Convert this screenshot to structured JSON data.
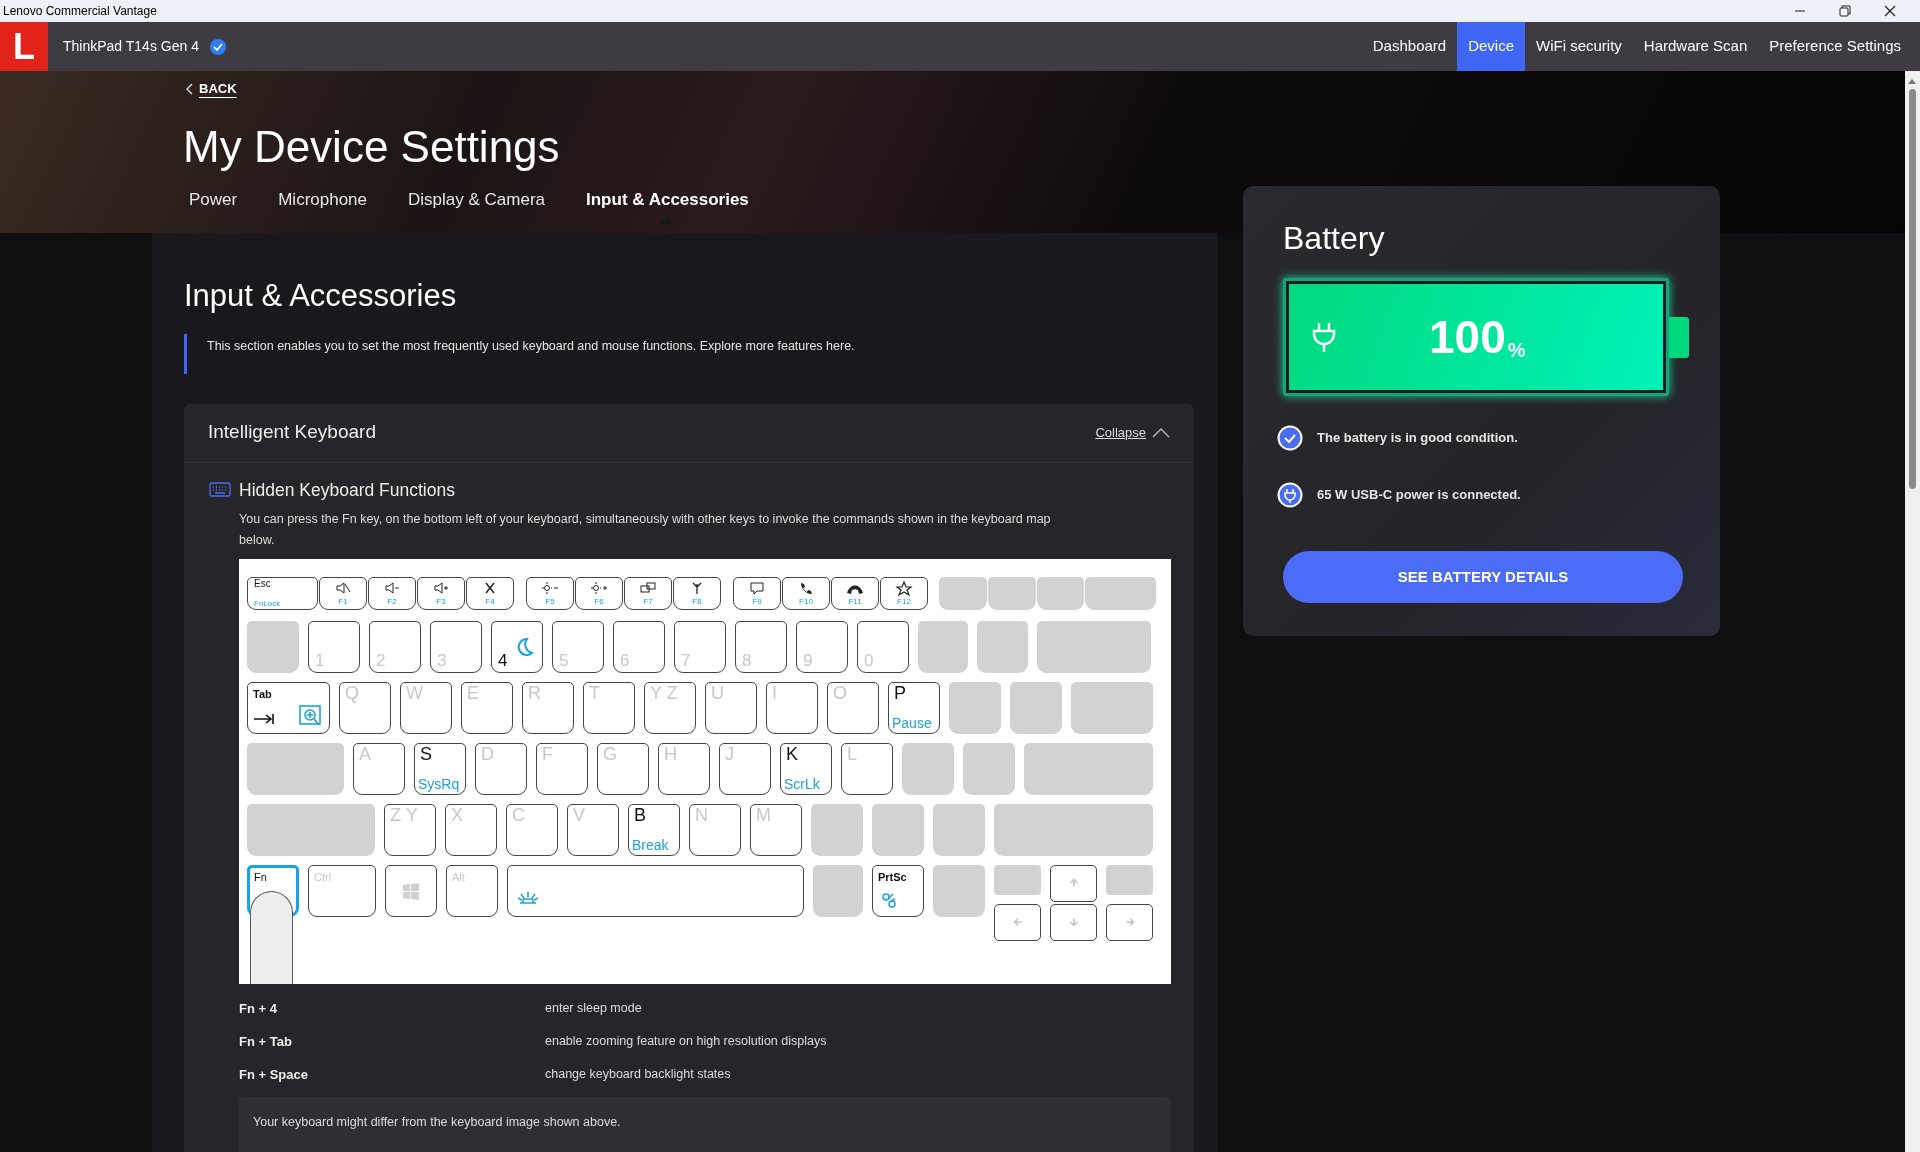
{
  "window": {
    "title": "Lenovo Commercial Vantage"
  },
  "header": {
    "logo": "L",
    "device_name": "ThinkPad T14s Gen 4",
    "verified": true,
    "nav": [
      {
        "label": "Dashboard",
        "selected": false
      },
      {
        "label": "Device",
        "selected": true
      },
      {
        "label": "WiFi security",
        "selected": false
      },
      {
        "label": "Hardware Scan",
        "selected": false
      },
      {
        "label": "Preference Settings",
        "selected": false
      }
    ]
  },
  "hero": {
    "back": "BACK",
    "title": "My Device Settings",
    "tabs": [
      {
        "label": "Power",
        "selected": false
      },
      {
        "label": "Microphone",
        "selected": false
      },
      {
        "label": "Display & Camera",
        "selected": false
      },
      {
        "label": "Input & Accessories",
        "selected": true
      }
    ]
  },
  "section": {
    "title": "Input & Accessories",
    "intro": "This section enables you to set the most frequently used keyboard and mouse functions. Explore more features here."
  },
  "card": {
    "title": "Intelligent Keyboard",
    "collapse": "Collapse",
    "expanded": true,
    "feature": {
      "title": "Hidden Keyboard Functions",
      "description": "You can press the Fn key, on the bottom left of your keyboard, simultaneously with other keys to invoke the commands shown in the keyboard map below."
    },
    "keyboard": {
      "rows": [
        {
          "keys": [
            {
              "kind": "function",
              "label": "Esc",
              "sub": "FnLock"
            },
            {
              "kind": "fkey",
              "sub": "F1"
            },
            {
              "kind": "fkey",
              "sub": "F2"
            },
            {
              "kind": "fkey",
              "sub": "F3"
            },
            {
              "kind": "fkey",
              "sub": "F4"
            },
            {
              "kind": "fkey",
              "sub": "F5"
            },
            {
              "kind": "fkey",
              "sub": "F6"
            },
            {
              "kind": "fkey",
              "sub": "F7"
            },
            {
              "kind": "fkey",
              "sub": "F8"
            },
            {
              "kind": "fkey",
              "sub": "F9"
            },
            {
              "kind": "fkey",
              "sub": "F10"
            },
            {
              "kind": "fkey",
              "sub": "F11"
            },
            {
              "kind": "fkey",
              "sub": "F12"
            },
            {
              "kind": "blank"
            },
            {
              "kind": "blank"
            },
            {
              "kind": "blank"
            },
            {
              "kind": "blank"
            }
          ]
        },
        {
          "keys": [
            {
              "kind": "blank"
            },
            {
              "kind": "plain",
              "label": "1"
            },
            {
              "kind": "plain",
              "label": "2"
            },
            {
              "kind": "plain",
              "label": "3"
            },
            {
              "kind": "function",
              "label": "4"
            },
            {
              "kind": "plain",
              "label": "5"
            },
            {
              "kind": "plain",
              "label": "6"
            },
            {
              "kind": "plain",
              "label": "7"
            },
            {
              "kind": "plain",
              "label": "8"
            },
            {
              "kind": "plain",
              "label": "9"
            },
            {
              "kind": "plain",
              "label": "0"
            },
            {
              "kind": "blank"
            },
            {
              "kind": "blank"
            },
            {
              "kind": "blank"
            }
          ]
        },
        {
          "keys": [
            {
              "kind": "function",
              "label": "Tab"
            },
            {
              "kind": "plain",
              "label": "Q"
            },
            {
              "kind": "plain",
              "label": "W"
            },
            {
              "kind": "plain",
              "label": "E"
            },
            {
              "kind": "plain",
              "label": "R"
            },
            {
              "kind": "plain",
              "label": "T"
            },
            {
              "kind": "plain",
              "label": "Y Z"
            },
            {
              "kind": "plain",
              "label": "U"
            },
            {
              "kind": "plain",
              "label": "I"
            },
            {
              "kind": "plain",
              "label": "O"
            },
            {
              "kind": "function",
              "label": "P",
              "sub": "Pause"
            },
            {
              "kind": "blank"
            },
            {
              "kind": "blank"
            },
            {
              "kind": "blank"
            }
          ]
        },
        {
          "keys": [
            {
              "kind": "blank"
            },
            {
              "kind": "plain",
              "label": "A"
            },
            {
              "kind": "function",
              "label": "S",
              "sub": "SysRq"
            },
            {
              "kind": "plain",
              "label": "D"
            },
            {
              "kind": "plain",
              "label": "F"
            },
            {
              "kind": "plain",
              "label": "G"
            },
            {
              "kind": "plain",
              "label": "H"
            },
            {
              "kind": "plain",
              "label": "J"
            },
            {
              "kind": "function",
              "label": "K",
              "sub": "ScrLk"
            },
            {
              "kind": "plain",
              "label": "L"
            },
            {
              "kind": "blank"
            },
            {
              "kind": "blank"
            },
            {
              "kind": "blank"
            }
          ]
        },
        {
          "keys": [
            {
              "kind": "blank"
            },
            {
              "kind": "plain",
              "label": "Z Y"
            },
            {
              "kind": "plain",
              "label": "X"
            },
            {
              "kind": "plain",
              "label": "C"
            },
            {
              "kind": "plain",
              "label": "V"
            },
            {
              "kind": "function",
              "label": "B",
              "sub": "Break"
            },
            {
              "kind": "plain",
              "label": "N"
            },
            {
              "kind": "plain",
              "label": "M"
            },
            {
              "kind": "blank"
            },
            {
              "kind": "blank"
            },
            {
              "kind": "blank"
            },
            {
              "kind": "blank"
            }
          ]
        },
        {
          "keys": [
            {
              "kind": "pressed",
              "label": "Fn"
            },
            {
              "kind": "plain",
              "label": "Ctrl"
            },
            {
              "kind": "plain"
            },
            {
              "kind": "plain",
              "label": "Alt"
            },
            {
              "kind": "plain"
            },
            {
              "kind": "blank"
            },
            {
              "kind": "function",
              "label": "PrtSc"
            },
            {
              "kind": "blank"
            },
            {
              "kind": "arrows"
            }
          ]
        }
      ]
    },
    "shortcuts": [
      {
        "keys": "Fn + 4",
        "action": "enter sleep mode"
      },
      {
        "keys": "Fn + Tab",
        "action": "enable zooming feature on high resolution displays"
      },
      {
        "keys": "Fn + Space",
        "action": "change keyboard backlight states"
      }
    ],
    "note": "Your keyboard might differ from the keyboard image shown above."
  },
  "battery": {
    "title": "Battery",
    "level": 1,
    "reading": "100",
    "unit": "%",
    "charging": true,
    "statuses": [
      {
        "kind": "check",
        "text": "The battery is in good condition."
      },
      {
        "kind": "power",
        "text": "65 W USB-C power is connected."
      }
    ],
    "button": "SEE BATTERY DETAILS"
  }
}
